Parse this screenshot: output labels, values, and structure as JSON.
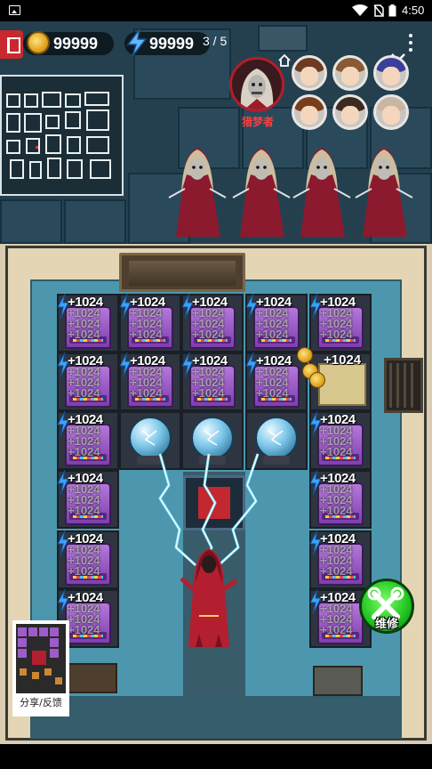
{
  "status_bar": {
    "time": "4:50"
  },
  "hud": {
    "coins": "99999",
    "energy": "99999",
    "wave": "3 / 5",
    "menu_icon": "more-vert-icon"
  },
  "roster": {
    "dream_hunter_label": "猎梦者",
    "players": [
      {
        "hair": "#6b3b22"
      },
      {
        "hair": "#8a5a34"
      },
      {
        "hair": "#3b3f9a"
      },
      {
        "hair": "#7a3d1c"
      },
      {
        "hair": "#3a2a20"
      },
      {
        "hair": "#c8b6a2"
      }
    ]
  },
  "grid": {
    "bonus_label": "+1024",
    "ghost_texts": [
      "+1024",
      "+1024",
      "+1024"
    ]
  },
  "repair": {
    "label": "维修"
  },
  "share": {
    "label": "分享/反馈"
  },
  "colors": {
    "machine_purple": "#9d5cc9",
    "orb_blue": "#7ac6e8",
    "repair_green": "#1fc21f",
    "hunter_red": "#c8292f"
  }
}
